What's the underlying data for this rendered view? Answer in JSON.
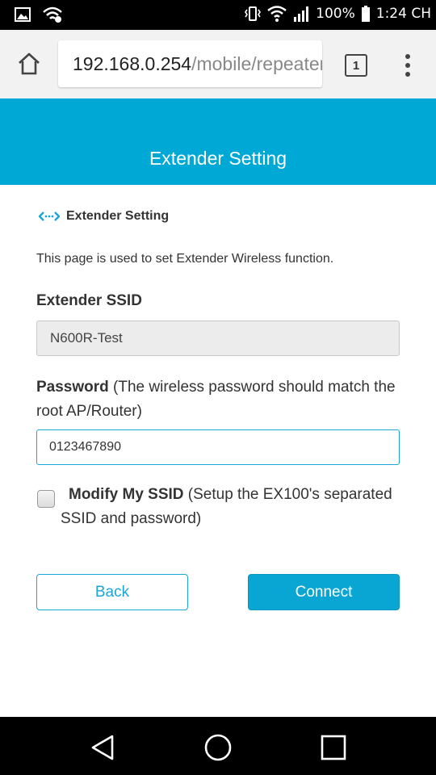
{
  "status_bar": {
    "icons_left": [
      "gallery-icon",
      "wifi-calling-icon"
    ],
    "icons_right": [
      "vibrate-icon",
      "wifi-icon",
      "signal-icon",
      "battery-icon"
    ],
    "battery": "100%",
    "time": "1:24 CH"
  },
  "browser": {
    "url_host": "192.168.0.254",
    "url_path": "/mobile/repeater",
    "tab_count": "1"
  },
  "banner": {
    "title": "Extender Setting"
  },
  "section": {
    "icon": "extender-arrows-icon",
    "heading": "Extender Setting",
    "description": "This page is used to set Extender Wireless function."
  },
  "form": {
    "ssid_label": "Extender SSID",
    "ssid_value": "N600R-Test",
    "password_label_bold": "Password",
    "password_label_note": " (The wireless password should match the root AP/Router)",
    "password_value": "0123467890",
    "modify_checked": false,
    "modify_label_bold": "Modify My SSID",
    "modify_label_note": " (Setup the EX100's separated SSID and password)"
  },
  "buttons": {
    "back": "Back",
    "connect": "Connect"
  },
  "colors": {
    "accent": "#00a8d6",
    "button_primary": "#0aa6d3"
  }
}
